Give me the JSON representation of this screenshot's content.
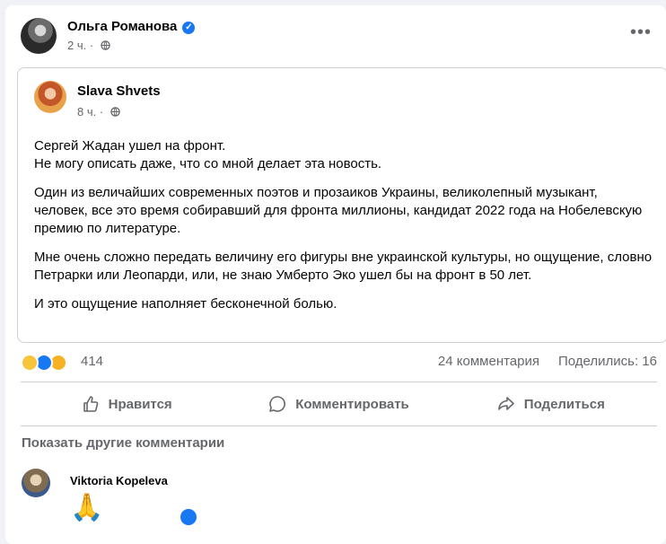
{
  "post": {
    "author": "Ольга Романова",
    "time": "2 ч. ·",
    "more": "•••"
  },
  "shared": {
    "author": "Slava Shvets",
    "time": "8 ч. ·",
    "paragraphs": [
      "Сергей Жадан ушел на фронт.\nНе могу описать даже, что со мной делает эта новость.",
      "Один из величайших современных поэтов и прозаиков Украины, великолепный музыкант, человек, все это время собиравший для фронта миллионы, кандидат 2022 года на Нобелевскую премию по литературе.",
      "Мне очень сложно передать величину его фигуры вне украинской культуры, но ощущение, словно Петрарки или Леопарди, или, не знаю Умберто Эко ушел бы на фронт в 50 лет.",
      "И это ощущение наполняет бесконечной болью."
    ]
  },
  "stats": {
    "reactions": "414",
    "comments": "24 комментария",
    "shares": "Поделились: 16"
  },
  "actions": {
    "like": "Нравится",
    "comment": "Комментировать",
    "share": "Поделиться"
  },
  "comments": {
    "more_label": "Показать другие комментарии",
    "first": {
      "name": "Viktoria Kopeleva",
      "emoji": "🙏"
    }
  },
  "colors": {
    "accent": "#1877f2",
    "secondary_text": "#65676b",
    "background": "#f0f2f5"
  }
}
